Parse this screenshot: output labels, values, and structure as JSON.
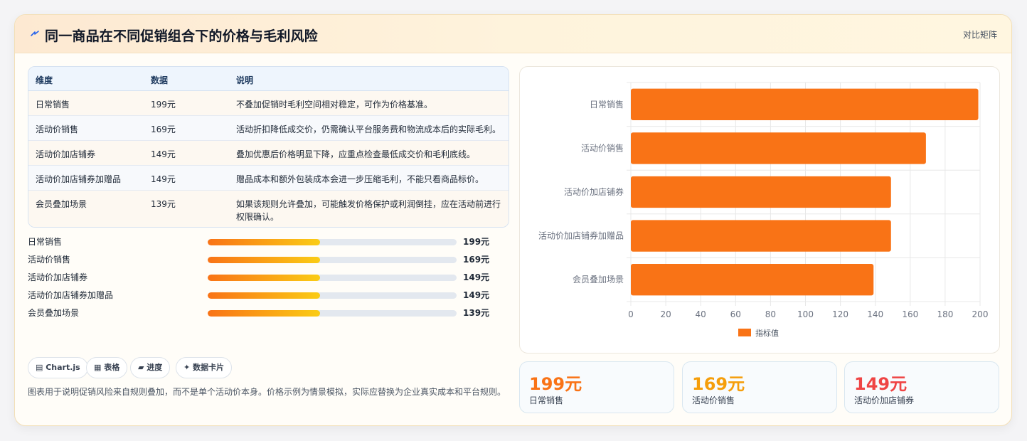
{
  "header": {
    "title": "同一商品在不同促销组合下的价格与毛利风险",
    "link": "对比矩阵"
  },
  "table": {
    "columns": [
      "维度",
      "数据",
      "说明"
    ],
    "rows": [
      [
        "日常销售",
        "199元",
        "不叠加促销时毛利空间相对稳定，可作为价格基准。"
      ],
      [
        "活动价销售",
        "169元",
        "活动折扣降低成交价，仍需确认平台服务费和物流成本后的实际毛利。"
      ],
      [
        "活动价加店铺券",
        "149元",
        "叠加优惠后价格明显下降，应重点检查最低成交价和毛利底线。"
      ],
      [
        "活动价加店铺券加赠品",
        "149元",
        "赠品成本和额外包装成本会进一步压缩毛利，不能只看商品标价。"
      ],
      [
        "会员叠加场景",
        "139元",
        "如果该规则允许叠加，可能触发价格保护或利润倒挂，应在活动前进行权限确认。"
      ]
    ]
  },
  "progress": [
    {
      "label": "日常销售",
      "value": "199元",
      "fraction": 0.45
    },
    {
      "label": "活动价销售",
      "value": "169元",
      "fraction": 0.45
    },
    {
      "label": "活动价加店铺券",
      "value": "149元",
      "fraction": 0.45
    },
    {
      "label": "活动价加店铺券加赠品",
      "value": "149元",
      "fraction": 0.45
    },
    {
      "label": "会员叠加场景",
      "value": "139元",
      "fraction": 0.45
    }
  ],
  "chips": [
    "▤ Chart.js",
    "▦ 表格",
    "▰ 进度",
    "✦ 数据卡片"
  ],
  "note": "图表用于说明促销风险来自规则叠加，而不是单个活动价本身。价格示例为情景模拟，实际应替换为企业真实成本和平台规则。",
  "kpis": [
    {
      "value": "199元",
      "label": "日常销售",
      "color": "#f97316"
    },
    {
      "value": "169元",
      "label": "活动价销售",
      "color": "#f59e0b"
    },
    {
      "value": "149元",
      "label": "活动价加店铺券",
      "color": "#ef4444"
    }
  ],
  "chart_data": {
    "type": "bar",
    "orientation": "horizontal",
    "categories": [
      "日常销售",
      "活动价销售",
      "活动价加店铺券",
      "活动价加店铺券加赠品",
      "会员叠加场景"
    ],
    "series": [
      {
        "name": "指标值",
        "values": [
          199,
          169,
          149,
          149,
          139
        ],
        "color": "#f97316"
      }
    ],
    "xlim": [
      0,
      200
    ],
    "xticks": [
      0,
      20,
      40,
      60,
      80,
      100,
      120,
      140,
      160,
      180,
      200
    ],
    "grid": true,
    "legend": "bottom"
  }
}
